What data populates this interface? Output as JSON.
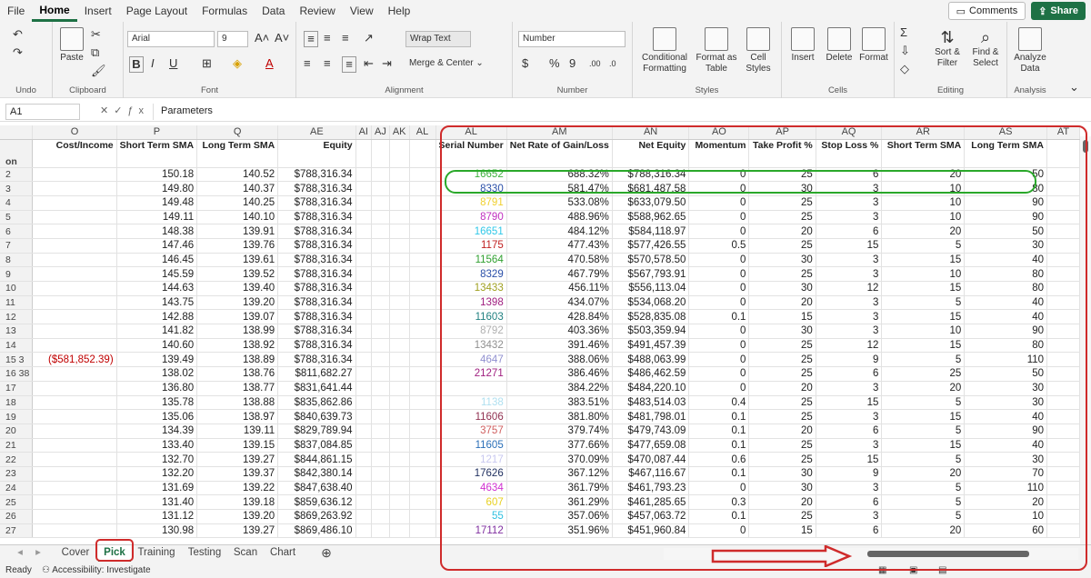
{
  "menu": [
    "File",
    "Home",
    "Insert",
    "Page Layout",
    "Formulas",
    "Data",
    "Review",
    "View",
    "Help"
  ],
  "actions": {
    "comments": "Comments",
    "share": "Share"
  },
  "ribbon": {
    "undo_label": "Undo",
    "clipboard": {
      "paste": "Paste",
      "label": "Clipboard"
    },
    "font": {
      "name": "Arial",
      "size": "9",
      "label": "Font"
    },
    "alignment": {
      "wrap": "Wrap Text",
      "merge": "Merge & Center",
      "label": "Alignment"
    },
    "number": {
      "format": "Number",
      "label": "Number"
    },
    "styles": {
      "conditional": "Conditional Formatting",
      "format_table": "Format as Table",
      "cell_styles": "Cell Styles",
      "label": "Styles"
    },
    "cells": {
      "insert": "Insert",
      "delete": "Delete",
      "format": "Format",
      "label": "Cells"
    },
    "editing": {
      "sort": "Sort & Filter",
      "find": "Find & Select",
      "label": "Editing"
    },
    "analysis": {
      "analyze": "Analyze Data",
      "label": "Analysis"
    }
  },
  "formula_bar": {
    "cell": "A1",
    "content": "Parameters"
  },
  "columns": [
    "",
    "O",
    "P",
    "Q",
    "AE",
    "AI",
    "AJ",
    "AK",
    "AL",
    "AL",
    "AM",
    "AN",
    "AO",
    "AP",
    "AQ",
    "AR",
    "AS",
    "AT"
  ],
  "headers": [
    "on",
    "Cost/Income",
    "Short Term SMA",
    "Long Term SMA",
    "Equity",
    "",
    "",
    "",
    "",
    "Serial Number",
    "Net Rate of Gain/Loss",
    "Net Equity",
    "Momentum",
    "Take Profit %",
    "Stop Loss %",
    "Short Term SMA",
    "Long Term SMA",
    ""
  ],
  "rows": [
    {
      "n": "2",
      "a": "",
      "o": "",
      "p": "150.18",
      "q": "140.52",
      "ae": "$788,316.34",
      "al": "16652",
      "c": "#3db03d",
      "am": "688.32%",
      "an": "$788,316.34",
      "ao": "0",
      "ap": "25",
      "aq": "6",
      "ar": "20",
      "as": "50"
    },
    {
      "n": "3",
      "a": "",
      "o": "",
      "p": "149.80",
      "q": "140.37",
      "ae": "$788,316.34",
      "al": "8330",
      "c": "#2a4fa8",
      "am": "581.47%",
      "an": "$681,487.58",
      "ao": "0",
      "ap": "30",
      "aq": "3",
      "ar": "10",
      "as": "80"
    },
    {
      "n": "4",
      "a": "",
      "o": "",
      "p": "149.48",
      "q": "140.25",
      "ae": "$788,316.34",
      "al": "8791",
      "c": "#f0d030",
      "am": "533.08%",
      "an": "$633,079.50",
      "ao": "0",
      "ap": "25",
      "aq": "3",
      "ar": "10",
      "as": "90"
    },
    {
      "n": "5",
      "a": "",
      "o": "",
      "p": "149.11",
      "q": "140.10",
      "ae": "$788,316.34",
      "al": "8790",
      "c": "#c030c0",
      "am": "488.96%",
      "an": "$588,962.65",
      "ao": "0",
      "ap": "25",
      "aq": "3",
      "ar": "10",
      "as": "90"
    },
    {
      "n": "6",
      "a": "",
      "o": "",
      "p": "148.38",
      "q": "139.91",
      "ae": "$788,316.34",
      "al": "16651",
      "c": "#30c8e8",
      "am": "484.12%",
      "an": "$584,118.97",
      "ao": "0",
      "ap": "20",
      "aq": "6",
      "ar": "20",
      "as": "50"
    },
    {
      "n": "7",
      "a": "",
      "o": "",
      "p": "147.46",
      "q": "139.76",
      "ae": "$788,316.34",
      "al": "1175",
      "c": "#c02020",
      "am": "477.43%",
      "an": "$577,426.55",
      "ao": "0.5",
      "ap": "25",
      "aq": "15",
      "ar": "5",
      "as": "30"
    },
    {
      "n": "8",
      "a": "",
      "o": "",
      "p": "146.45",
      "q": "139.61",
      "ae": "$788,316.34",
      "al": "11564",
      "c": "#30a030",
      "am": "470.58%",
      "an": "$570,578.50",
      "ao": "0",
      "ap": "30",
      "aq": "3",
      "ar": "15",
      "as": "40"
    },
    {
      "n": "9",
      "a": "",
      "o": "",
      "p": "145.59",
      "q": "139.52",
      "ae": "$788,316.34",
      "al": "8329",
      "c": "#2a4fa8",
      "am": "467.79%",
      "an": "$567,793.91",
      "ao": "0",
      "ap": "25",
      "aq": "3",
      "ar": "10",
      "as": "80"
    },
    {
      "n": "10",
      "a": "",
      "o": "",
      "p": "144.63",
      "q": "139.40",
      "ae": "$788,316.34",
      "al": "13433",
      "c": "#a0a020",
      "am": "456.11%",
      "an": "$556,113.04",
      "ao": "0",
      "ap": "30",
      "aq": "12",
      "ar": "15",
      "as": "80"
    },
    {
      "n": "11",
      "a": "",
      "o": "",
      "p": "143.75",
      "q": "139.20",
      "ae": "$788,316.34",
      "al": "1398",
      "c": "#a02080",
      "am": "434.07%",
      "an": "$534,068.20",
      "ao": "0",
      "ap": "20",
      "aq": "3",
      "ar": "5",
      "as": "40"
    },
    {
      "n": "12",
      "a": "",
      "o": "",
      "p": "142.88",
      "q": "139.07",
      "ae": "$788,316.34",
      "al": "11603",
      "c": "#208080",
      "am": "428.84%",
      "an": "$528,835.08",
      "ao": "0.1",
      "ap": "15",
      "aq": "3",
      "ar": "15",
      "as": "40"
    },
    {
      "n": "13",
      "a": "",
      "o": "",
      "p": "141.82",
      "q": "138.99",
      "ae": "$788,316.34",
      "al": "8792",
      "c": "#b0b0b0",
      "am": "403.36%",
      "an": "$503,359.94",
      "ao": "0",
      "ap": "30",
      "aq": "3",
      "ar": "10",
      "as": "90"
    },
    {
      "n": "14",
      "a": "",
      "o": "",
      "p": "140.60",
      "q": "138.92",
      "ae": "$788,316.34",
      "al": "13432",
      "c": "#909090",
      "am": "391.46%",
      "an": "$491,457.39",
      "ao": "0",
      "ap": "25",
      "aq": "12",
      "ar": "15",
      "as": "80"
    },
    {
      "n": "15",
      "a": "3",
      "o": "($581,852.39)",
      "p": "139.49",
      "q": "138.89",
      "ae": "$788,316.34",
      "al": "4647",
      "c": "#9090d0",
      "am": "388.06%",
      "an": "$488,063.99",
      "ao": "0",
      "ap": "25",
      "aq": "9",
      "ar": "5",
      "as": "110"
    },
    {
      "n": "16",
      "a": "38",
      "o": "",
      "p": "138.02",
      "q": "138.76",
      "ae": "$811,682.27",
      "al": "21271",
      "c": "#a02080",
      "am": "386.46%",
      "an": "$486,462.59",
      "ao": "0",
      "ap": "25",
      "aq": "6",
      "ar": "25",
      "as": "50"
    },
    {
      "n": "17",
      "a": "",
      "o": "",
      "p": "136.80",
      "q": "138.77",
      "ae": "$831,641.44",
      "al": "",
      "c": "#f0e060",
      "am": "384.22%",
      "an": "$484,220.10",
      "ao": "0",
      "ap": "20",
      "aq": "3",
      "ar": "20",
      "as": "30"
    },
    {
      "n": "18",
      "a": "",
      "o": "",
      "p": "135.78",
      "q": "138.88",
      "ae": "$835,862.86",
      "al": "1138",
      "c": "#b0e0f0",
      "am": "383.51%",
      "an": "$483,514.03",
      "ao": "0.4",
      "ap": "25",
      "aq": "15",
      "ar": "5",
      "as": "30"
    },
    {
      "n": "19",
      "a": "",
      "o": "",
      "p": "135.06",
      "q": "138.97",
      "ae": "$840,639.73",
      "al": "11606",
      "c": "#903050",
      "am": "381.80%",
      "an": "$481,798.01",
      "ao": "0.1",
      "ap": "25",
      "aq": "3",
      "ar": "15",
      "as": "40"
    },
    {
      "n": "20",
      "a": "",
      "o": "",
      "p": "134.39",
      "q": "139.11",
      "ae": "$829,789.94",
      "al": "3757",
      "c": "#d06060",
      "am": "379.74%",
      "an": "$479,743.09",
      "ao": "0.1",
      "ap": "20",
      "aq": "6",
      "ar": "5",
      "as": "90"
    },
    {
      "n": "21",
      "a": "",
      "o": "",
      "p": "133.40",
      "q": "139.15",
      "ae": "$837,084.85",
      "al": "11605",
      "c": "#2a6fb8",
      "am": "377.66%",
      "an": "$477,659.08",
      "ao": "0.1",
      "ap": "25",
      "aq": "3",
      "ar": "15",
      "as": "40"
    },
    {
      "n": "22",
      "a": "",
      "o": "",
      "p": "132.70",
      "q": "139.27",
      "ae": "$844,861.15",
      "al": "1217",
      "c": "#c8c8f0",
      "am": "370.09%",
      "an": "$470,087.44",
      "ao": "0.6",
      "ap": "25",
      "aq": "15",
      "ar": "5",
      "as": "30"
    },
    {
      "n": "23",
      "a": "",
      "o": "",
      "p": "132.20",
      "q": "139.37",
      "ae": "$842,380.14",
      "al": "17626",
      "c": "#203060",
      "am": "367.12%",
      "an": "$467,116.67",
      "ao": "0.1",
      "ap": "30",
      "aq": "9",
      "ar": "20",
      "as": "70"
    },
    {
      "n": "24",
      "a": "",
      "o": "",
      "p": "131.69",
      "q": "139.22",
      "ae": "$847,638.40",
      "al": "4634",
      "c": "#d030d0",
      "am": "361.79%",
      "an": "$461,793.23",
      "ao": "0",
      "ap": "30",
      "aq": "3",
      "ar": "5",
      "as": "110"
    },
    {
      "n": "25",
      "a": "",
      "o": "",
      "p": "131.40",
      "q": "139.18",
      "ae": "$859,636.12",
      "al": "607",
      "c": "#e8d020",
      "am": "361.29%",
      "an": "$461,285.65",
      "ao": "0.3",
      "ap": "20",
      "aq": "6",
      "ar": "5",
      "as": "20"
    },
    {
      "n": "26",
      "a": "",
      "o": "",
      "p": "131.12",
      "q": "139.20",
      "ae": "$869,263.92",
      "al": "55",
      "c": "#30c0e0",
      "am": "357.06%",
      "an": "$457,063.72",
      "ao": "0.1",
      "ap": "25",
      "aq": "3",
      "ar": "5",
      "as": "10"
    },
    {
      "n": "27",
      "a": "",
      "o": "",
      "p": "130.98",
      "q": "139.27",
      "ae": "$869,486.10",
      "al": "17112",
      "c": "#8030a0",
      "am": "351.96%",
      "an": "$451,960.84",
      "ao": "0",
      "ap": "15",
      "aq": "6",
      "ar": "20",
      "as": "60"
    }
  ],
  "sheets": [
    "Cover",
    "Pick",
    "Training",
    "Testing",
    "Scan",
    "Chart"
  ],
  "active_sheet": "Pick",
  "status": {
    "ready": "Ready",
    "accessibility": "Accessibility: Investigate"
  }
}
